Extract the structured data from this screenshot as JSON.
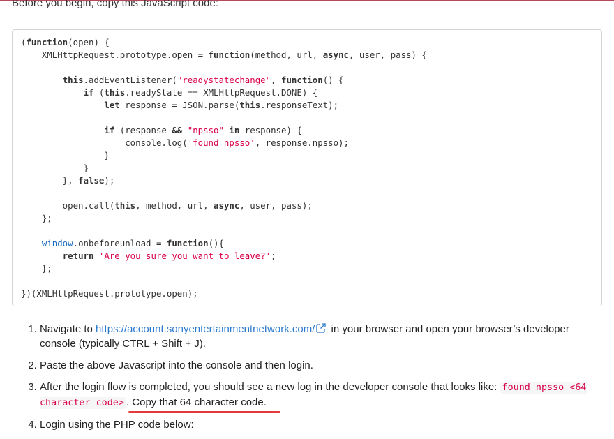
{
  "intro_text": "Before you begin, copy this JavaScript code:",
  "code_lines": [
    "(function(open) {",
    "    XMLHttpRequest.prototype.open = function(method, url, async, user, pass) {",
    "",
    "        this.addEventListener(\"readystatechange\", function() {",
    "            if (this.readyState == XMLHttpRequest.DONE) {",
    "                let response = JSON.parse(this.responseText);",
    "",
    "                if (response && \"npsso\" in response) {",
    "                    console.log('found npsso', response.npsso);",
    "                }",
    "            }",
    "        }, false);",
    "",
    "        open.call(this, method, url, async, user, pass);",
    "    };",
    "",
    "    window.onbeforeunload = function(){",
    "        return 'Are you sure you want to leave?';",
    "    };",
    "",
    "})(XMLHttpRequest.prototype.open);"
  ],
  "steps": {
    "s1_prefix": "Navigate to ",
    "s1_link": "https://account.sonyentertainmentnetwork.com/",
    "s1_suffix": " in your browser and open your browser’s developer console (typically CTRL + Shift + J).",
    "s2": "Paste the above Javascript into the console and then login.",
    "s3_prefix": "After the login flow is completed, you should see a new log in the developer console that looks like: ",
    "s3_code": "found npsso <64 character code>",
    "s3_suffix": ". Copy that 64 character code.",
    "s4": "Login using the PHP code below:"
  },
  "colors": {
    "accent_rule": "#b5495b",
    "string": "#d7004b",
    "link": "#2a7ad0",
    "underline": "#e23b3b"
  },
  "icons": {
    "external_link": "external-link-icon"
  }
}
